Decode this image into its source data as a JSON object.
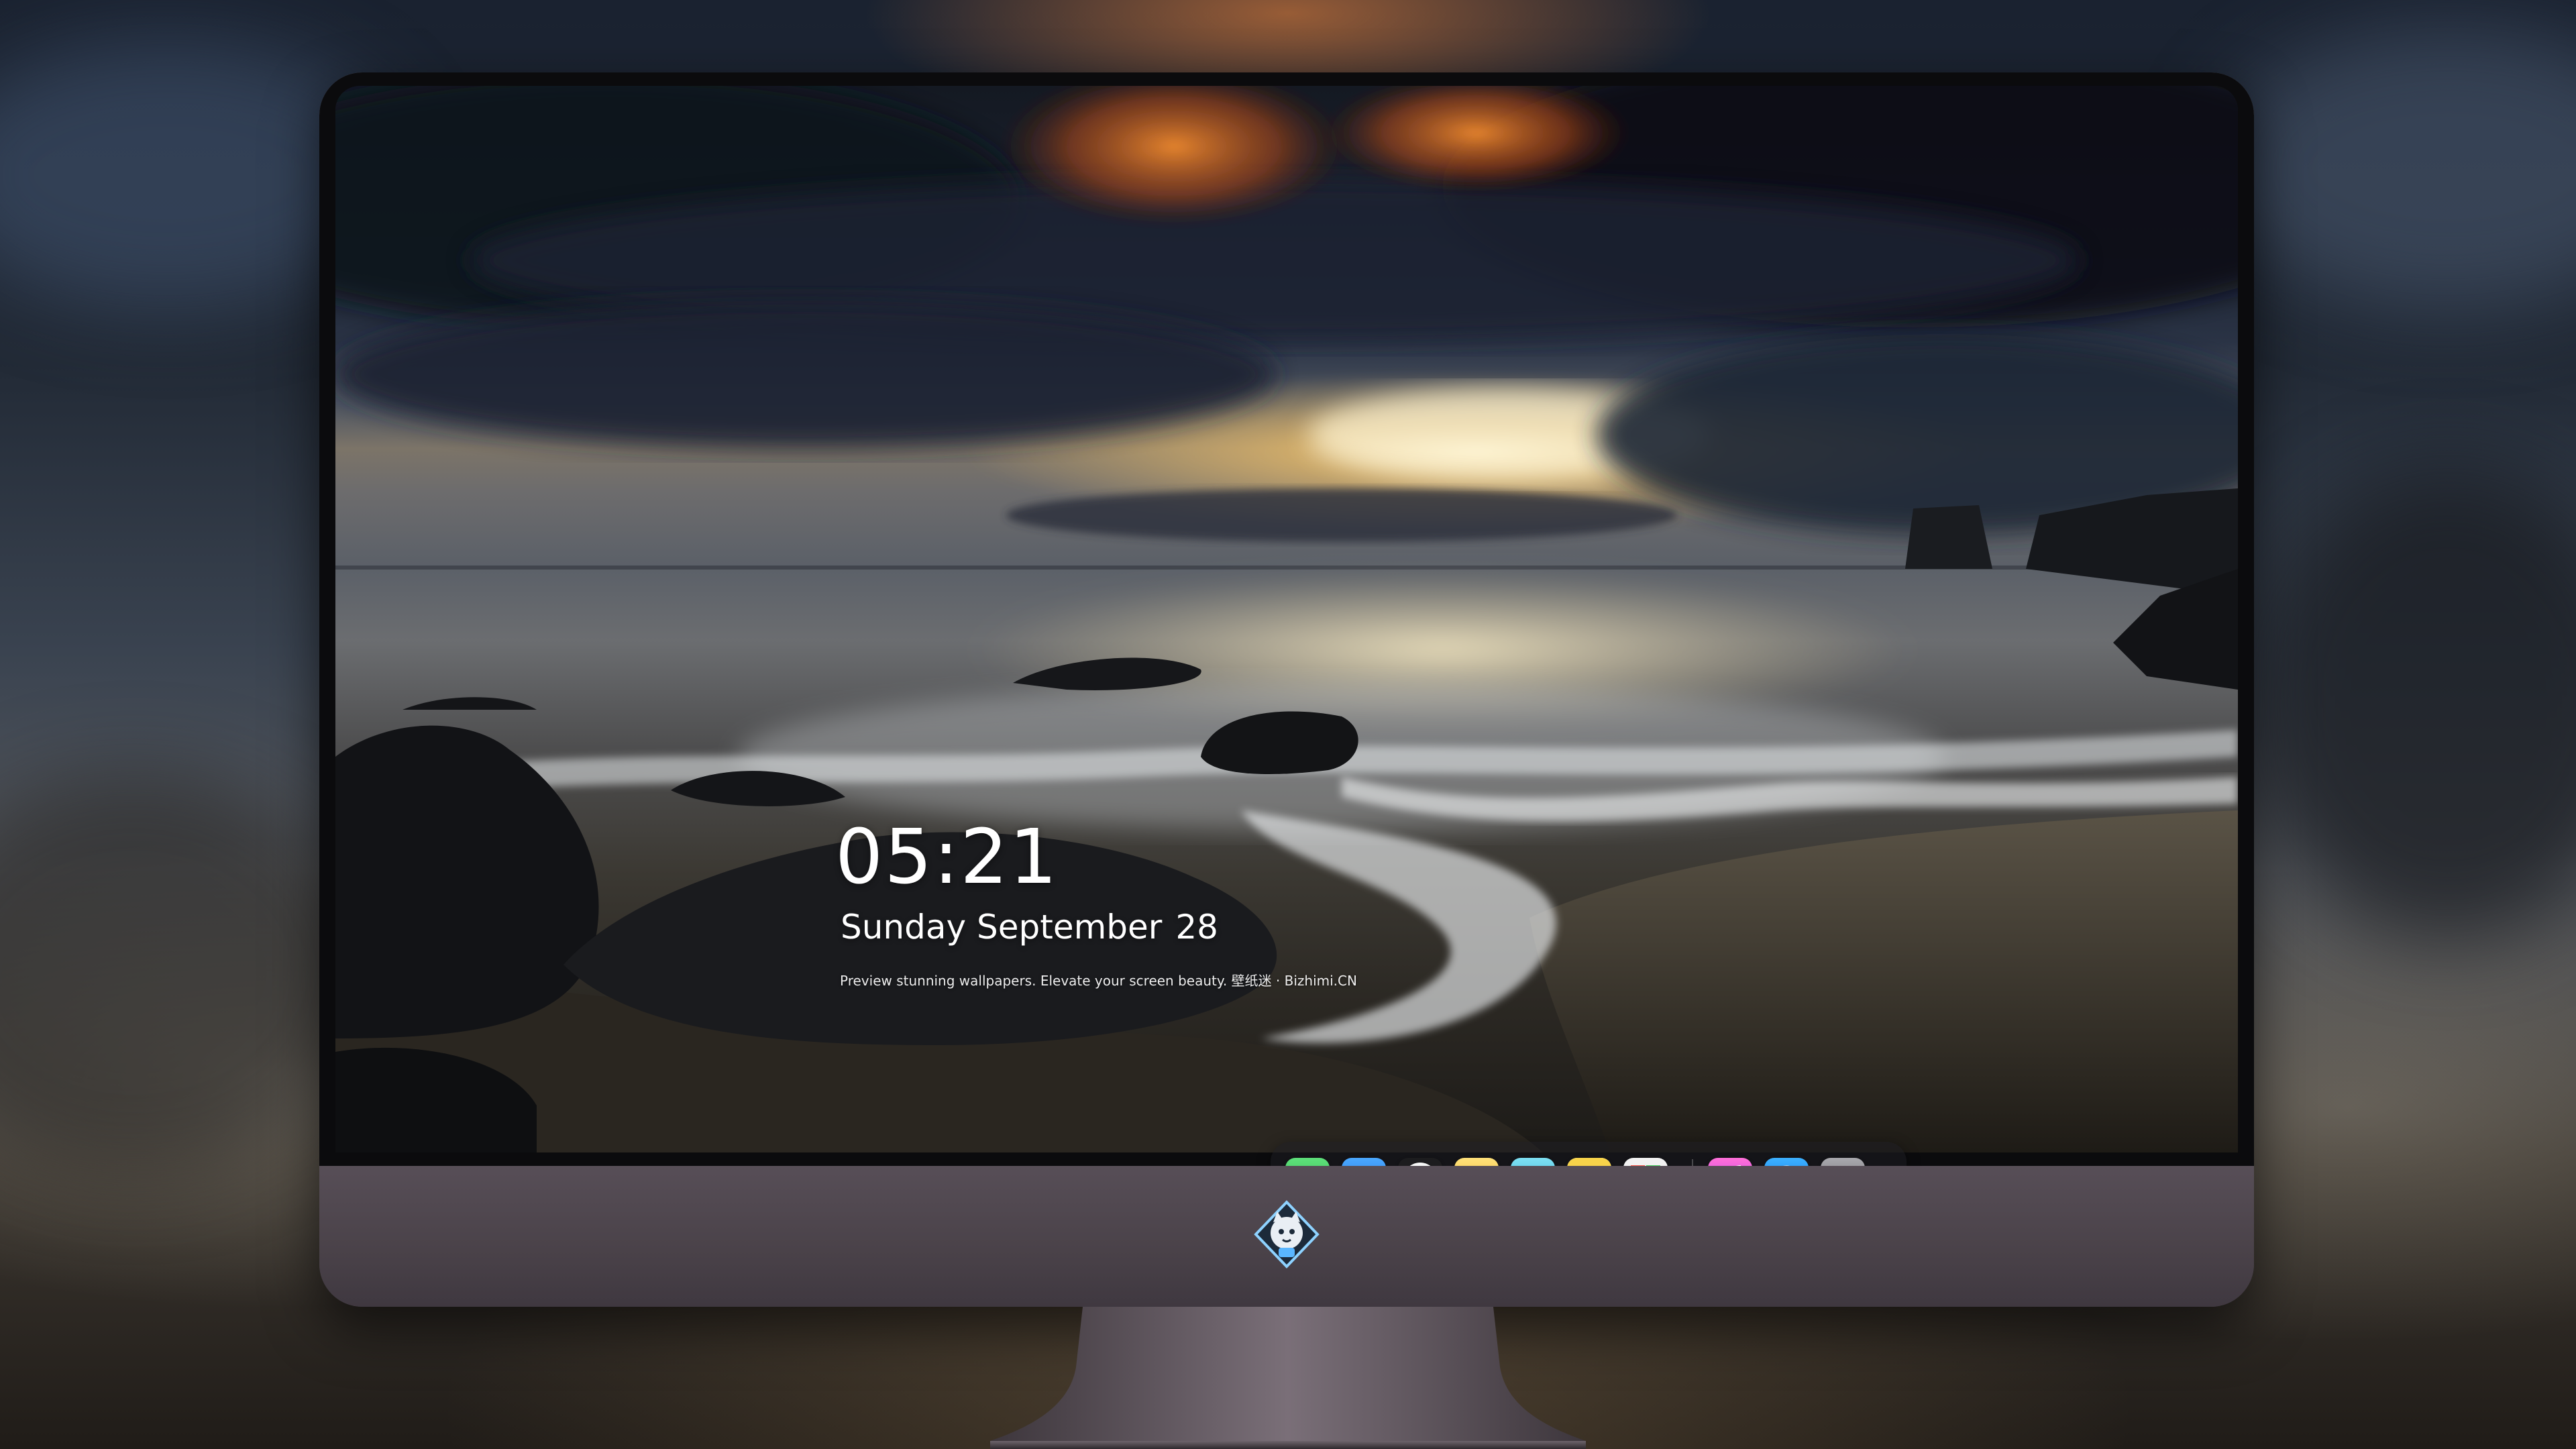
{
  "lock_screen": {
    "time": "05:21",
    "date_weekday_month": "Sunday September",
    "date_day": "28",
    "caption": "Preview stunning wallpapers. Elevate your screen beauty. 壁纸迷 · Bizhimi.CN"
  },
  "dock": {
    "apps": [
      {
        "name": "messages-icon",
        "color": "#35c759"
      },
      {
        "name": "weather-icon",
        "color": "#2f8cf3"
      },
      {
        "name": "clock-icon",
        "color": "#f5f5f5"
      },
      {
        "name": "preview-icon",
        "color": "#f0c93e"
      },
      {
        "name": "claquette-icon",
        "color": "#4fc9e8"
      },
      {
        "name": "notes-icon",
        "color": "#f7d34a"
      },
      {
        "name": "photo-booth-icon",
        "color": "#e8e8e8"
      }
    ],
    "pinned": [
      {
        "name": "music-icon",
        "color": "#e94bd6"
      },
      {
        "name": "app-store-icon",
        "color": "#1a8bff"
      },
      {
        "name": "camera-icon",
        "color": "#8e8e93"
      }
    ]
  },
  "brand": {
    "logo": "mascot-logo-icon"
  }
}
